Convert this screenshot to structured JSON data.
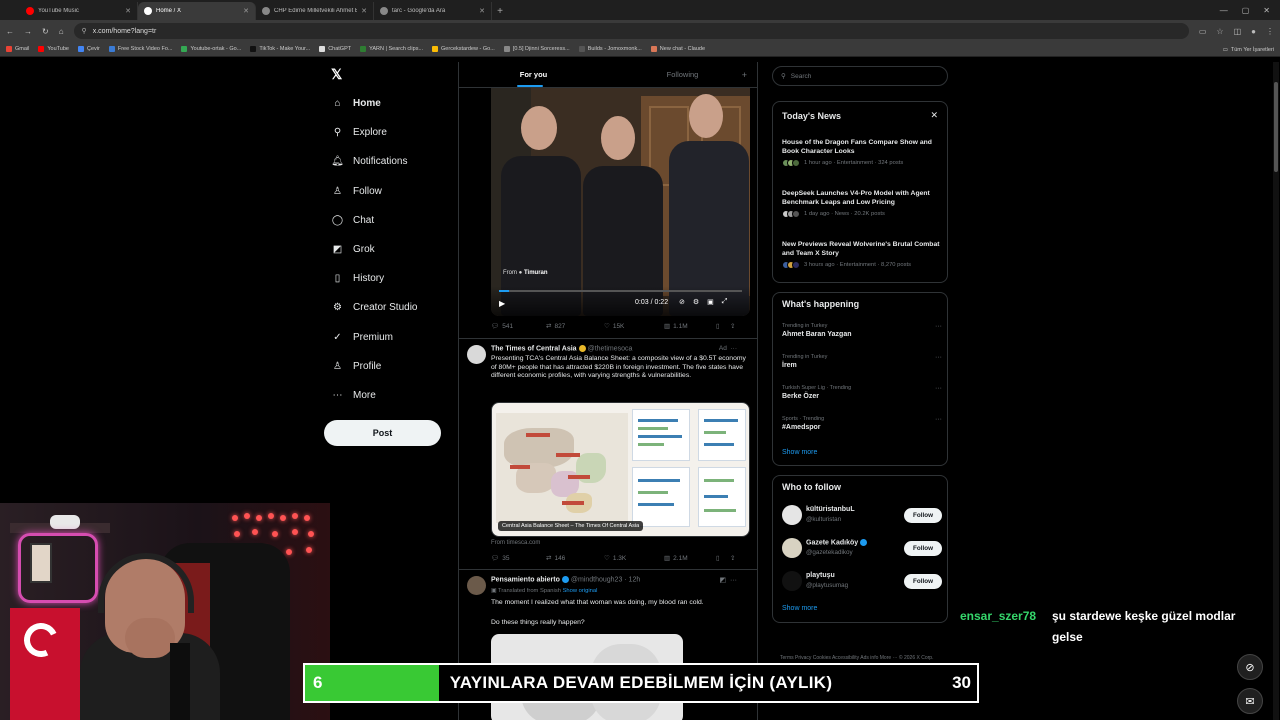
{
  "browser": {
    "tabs": [
      {
        "title": "YouTube Music",
        "color": "#ff0000"
      },
      {
        "title": "Home / X",
        "color": "#ffffff"
      },
      {
        "title": "CHP Edirne Milletvekili Ahmet Baran...",
        "color": "#888888"
      },
      {
        "title": "tarc - Google'da Ara",
        "color": "#888888"
      }
    ],
    "new_tab": "+",
    "url": "x.com/home?lang=tr",
    "bookmarks": [
      {
        "label": "Gmail",
        "color": "#ea4335"
      },
      {
        "label": "YouTube",
        "color": "#ff0000"
      },
      {
        "label": "Çevir",
        "color": "#4285f4"
      },
      {
        "label": "Free Stock Video Fo...",
        "color": "#3a7bd5"
      },
      {
        "label": "Youtube-ortak - Go...",
        "color": "#34a853"
      },
      {
        "label": "TikTok - Make Your...",
        "color": "#111111"
      },
      {
        "label": "ChatGPT",
        "color": "#dddddd"
      },
      {
        "label": "YARN | Search clips...",
        "color": "#2e7d32"
      },
      {
        "label": "Gercekstardew - Go...",
        "color": "#fbbc05"
      },
      {
        "label": "[0.5] Djinni Sorceress...",
        "color": "#888888"
      },
      {
        "label": "Builds - Jomoxmonk...",
        "color": "#555555"
      },
      {
        "label": "New chat - Claude",
        "color": "#d97757"
      }
    ],
    "bookmarks_right": "Tüm Yer İşaretleri"
  },
  "nav": {
    "items": [
      {
        "label": "Home",
        "icon": "home-icon",
        "glyph": "⌂"
      },
      {
        "label": "Explore",
        "icon": "search-icon",
        "glyph": "⚲"
      },
      {
        "label": "Notifications",
        "icon": "bell-icon",
        "glyph": "🔔︎"
      },
      {
        "label": "Follow",
        "icon": "add-user-icon",
        "glyph": "♙"
      },
      {
        "label": "Chat",
        "icon": "chat-icon",
        "glyph": "◯"
      },
      {
        "label": "Grok",
        "icon": "grok-icon",
        "glyph": "◩"
      },
      {
        "label": "History",
        "icon": "bookmark-icon",
        "glyph": "▯"
      },
      {
        "label": "Creator Studio",
        "icon": "studio-icon",
        "glyph": "⚙"
      },
      {
        "label": "Premium",
        "icon": "premium-icon",
        "glyph": "✓"
      },
      {
        "label": "Profile",
        "icon": "profile-icon",
        "glyph": "♙"
      },
      {
        "label": "More",
        "icon": "more-icon",
        "glyph": "⋯"
      }
    ],
    "post_label": "Post"
  },
  "feed": {
    "tab_for_you": "For you",
    "tab_following": "Following",
    "video": {
      "from_prefix": "From",
      "from_name": "Timuran",
      "time": "0:03 / 0:22"
    },
    "post1_actions": {
      "replies": "541",
      "reposts": "827",
      "likes": "15K",
      "views": "1.1M"
    },
    "post2": {
      "name": "The Times of Central Asia",
      "handle": "@thetimesoca",
      "ad": "Ad",
      "text": "Presenting TCA's Central Asia Balance Sheet: a composite view of a $0.5T economy of 80M+ people that has attracted $220B in foreign investment. The five states have different economic profiles, with varying strengths & vulnerabilities.",
      "image_caption": "Central Asia Balance Sheet – The Times Of Central Asia",
      "from_site": "From timesca.com",
      "actions": {
        "replies": "35",
        "reposts": "146",
        "likes": "1.3K",
        "views": "2.1M"
      }
    },
    "post3": {
      "name": "Pensamiento abierto",
      "handle": "@mindthough23 · 12h",
      "translated": "Translated from Spanish",
      "show_original": "Show original",
      "text1": "The moment I realized what that woman was doing, my blood ran cold.",
      "text2": "Do these things really happen?"
    }
  },
  "sidebar": {
    "search_placeholder": "Search",
    "todays_news": {
      "title": "Today's News",
      "items": [
        {
          "title": "House of the Dragon Fans Compare Show and Book Character Looks",
          "meta": "1 hour ago · Entertainment · 324 posts"
        },
        {
          "title": "DeepSeek Launches V4-Pro Model with Agent Benchmark Leaps and Low Pricing",
          "meta": "1 day ago · News · 20.2K posts"
        },
        {
          "title": "New Previews Reveal Wolverine's Brutal Combat and Team X Story",
          "meta": "3 hours ago · Entertainment · 8,270 posts"
        }
      ]
    },
    "whats_happening": {
      "title": "What's happening",
      "trends": [
        {
          "meta": "Trending in Turkey",
          "name": "Ahmet Baran Yazgan"
        },
        {
          "meta": "Trending in Turkey",
          "name": "İrem"
        },
        {
          "meta": "Turkish Super Lig · Trending",
          "name": "Berke Özer"
        },
        {
          "meta": "Sports · Trending",
          "name": "#Amedspor"
        }
      ],
      "show_more": "Show more"
    },
    "who_to_follow": {
      "title": "Who to follow",
      "accounts": [
        {
          "name": "kültüristanbuL",
          "handle": "@kulturistan",
          "button": "Follow"
        },
        {
          "name": "Gazete Kadıköy",
          "handle": "@gazetekadikoy",
          "button": "Follow"
        },
        {
          "name": "playtuşu",
          "handle": "@playtusumag",
          "button": "Follow"
        }
      ],
      "show_more": "Show more"
    },
    "footer": "Terms   Privacy   Cookies   Accessibility   Ads info   More ···   © 2026 X Corp."
  },
  "overlay": {
    "chat_user": "ensar_szer78",
    "chat_message": "şu stardewe keşke güzel modlar gelse",
    "goal_left": "6",
    "goal_text": "YAYINLARA DEVAM EDEBİLMEM İÇİN (AYLIK)",
    "goal_right": "30",
    "goal_progress": 0.2
  }
}
